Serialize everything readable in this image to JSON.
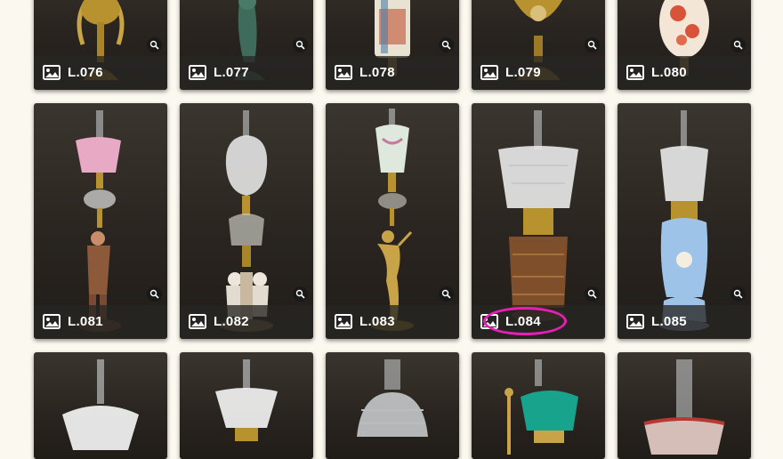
{
  "gallery": {
    "row1": [
      {
        "code": "L.076"
      },
      {
        "code": "L.077"
      },
      {
        "code": "L.078"
      },
      {
        "code": "L.079"
      },
      {
        "code": "L.080"
      }
    ],
    "row2": [
      {
        "code": "L.081"
      },
      {
        "code": "L.082"
      },
      {
        "code": "L.083"
      },
      {
        "code": "L.084"
      },
      {
        "code": "L.085"
      }
    ],
    "row3": [
      {
        "code": ""
      },
      {
        "code": ""
      },
      {
        "code": ""
      },
      {
        "code": ""
      },
      {
        "code": ""
      }
    ]
  },
  "icons": {
    "image": "image-icon",
    "zoom": "zoom-icon"
  },
  "annotation": {
    "highlight_color": "#e91eb7",
    "highlighted_item": "L.084"
  }
}
